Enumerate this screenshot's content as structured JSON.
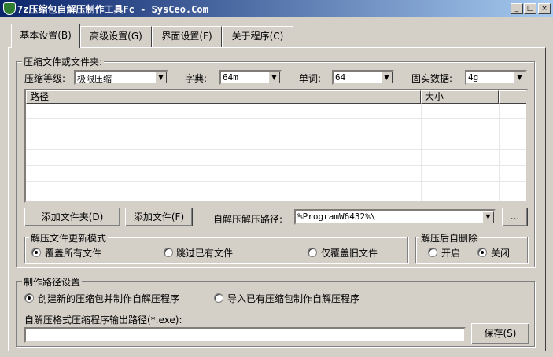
{
  "window": {
    "title": "7z压缩包自解压制作工具Fc - SysCeo.Com",
    "min_glyph": "_",
    "max_glyph": "□",
    "close_glyph": "×"
  },
  "tabs": [
    {
      "label": "基本设置(B)",
      "active": true
    },
    {
      "label": "高级设置(G)",
      "active": false
    },
    {
      "label": "界面设置(F)",
      "active": false
    },
    {
      "label": "关于程序(C)",
      "active": false
    }
  ],
  "compress_group": {
    "legend": "压缩文件或文件夹:",
    "level_label": "压缩等级:",
    "level_value": "极限压缩",
    "dict_label": "字典:",
    "dict_value": "64m",
    "word_label": "单词:",
    "word_value": "64",
    "solid_label": "固实数据:",
    "solid_value": "4g",
    "columns": [
      "路径",
      "大小",
      ""
    ],
    "add_folder_button": "添加文件夹(D)",
    "add_file_button": "添加文件(F)",
    "extract_path_label": "自解压解压路径:",
    "extract_path_value": "%ProgramW6432%\\",
    "browse_button": "..."
  },
  "update_mode": {
    "legend": "解压文件更新模式",
    "options": [
      "覆盖所有文件",
      "跳过已有文件",
      "仅覆盖旧文件"
    ],
    "selected": 0
  },
  "auto_delete": {
    "legend": "解压后自删除",
    "options": [
      "开启",
      "关闭"
    ],
    "selected": 1
  },
  "make_path": {
    "legend": "制作路径设置",
    "options": [
      "创建新的压缩包并制作自解压程序",
      "导入已有压缩包制作自解压程序"
    ],
    "selected": 0,
    "output_label": "自解压格式压缩程序输出路径(*.exe):",
    "output_value": "",
    "save_button": "保存(S)"
  },
  "colors": {
    "titlebar_start": "#0a246a",
    "titlebar_end": "#a6caf0",
    "face": "#d4d0c8"
  }
}
